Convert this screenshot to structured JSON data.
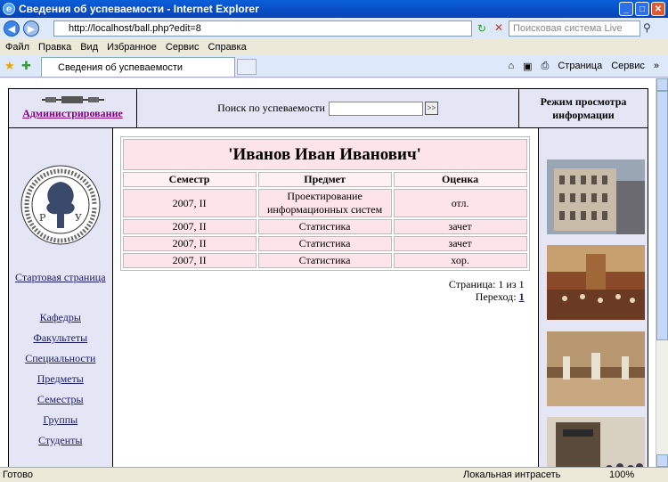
{
  "window": {
    "title": "Сведения об успеваемости - Internet Explorer"
  },
  "address": {
    "url": "http://localhost/ball.php?edit=8",
    "search_placeholder": "Поисковая система Live"
  },
  "menu": [
    "Файл",
    "Правка",
    "Вид",
    "Избранное",
    "Сервис",
    "Справка"
  ],
  "tab": {
    "label": "Сведения об успеваемости"
  },
  "toolbar": {
    "page_label": "Страница",
    "service_label": "Сервис"
  },
  "header": {
    "admin_label": "Администрирование",
    "search_label": "Поиск по успеваемости",
    "search_value": "",
    "search_button": ">>",
    "mode_label": "Режим просмотра информации"
  },
  "sidebar": {
    "home": "Стартовая страница",
    "items": [
      "Кафедры",
      "Факультеты",
      "Специальности",
      "Предметы",
      "Семестры",
      "Группы",
      "Студенты"
    ]
  },
  "student": {
    "name": "'Иванов Иван Иванович'"
  },
  "grades": {
    "columns": [
      "Семестр",
      "Предмет",
      "Оценка"
    ],
    "rows": [
      [
        "2007, II",
        "Проектирование информационных систем",
        "отл."
      ],
      [
        "2007, II",
        "Статистика",
        "зачет"
      ],
      [
        "2007, II",
        "Статистика",
        "зачет"
      ],
      [
        "2007, II",
        "Статистика",
        "хор."
      ]
    ]
  },
  "pager": {
    "text": "Страница: 1 из 1",
    "goto": "Переход:",
    "link": "1"
  },
  "status": {
    "left": "Готово",
    "zone": "Локальная интрасеть",
    "zoom": "100%"
  }
}
